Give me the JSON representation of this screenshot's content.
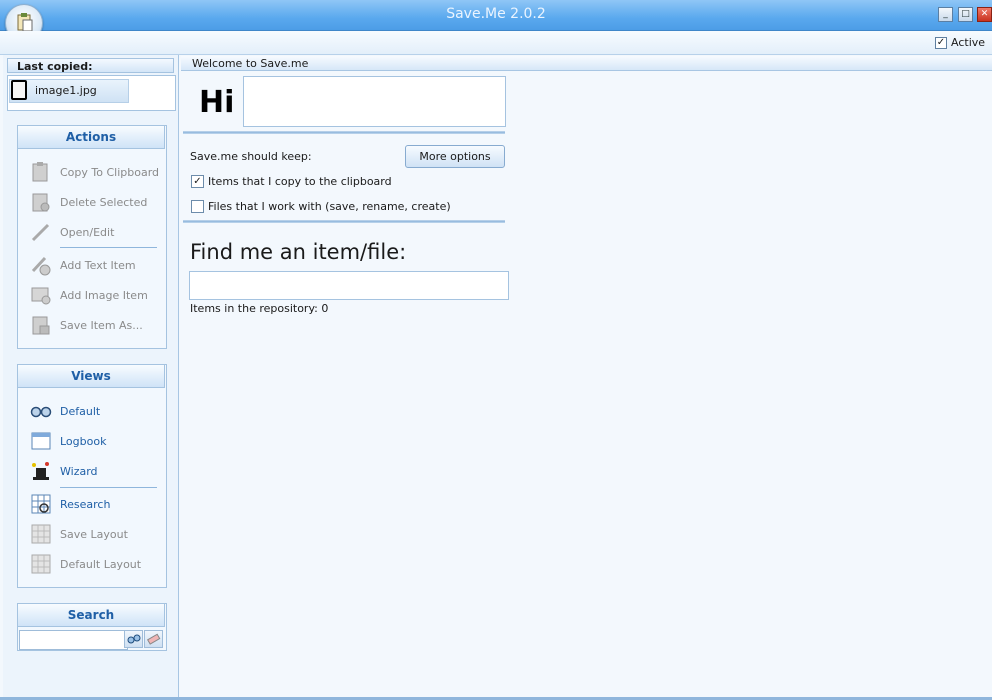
{
  "window": {
    "title": "Save.Me 2.0.2",
    "controls": {
      "minimize": "_",
      "maximize": "□",
      "close": "✕"
    }
  },
  "ribbon": {
    "active_label": "Active",
    "active_checked": true
  },
  "last_copied": {
    "header": "Last copied:",
    "file_name": "image1.jpg"
  },
  "actions": {
    "title": "Actions",
    "items": [
      {
        "label": "Copy To Clipboard",
        "icon": "clipboard-icon",
        "enabled": false
      },
      {
        "label": "Delete Selected",
        "icon": "delete-icon",
        "enabled": false
      },
      {
        "label": "Open/Edit",
        "icon": "pencil-icon",
        "enabled": false
      },
      {
        "label": "Add Text Item",
        "icon": "add-text-icon",
        "enabled": false
      },
      {
        "label": "Add Image Item",
        "icon": "add-image-icon",
        "enabled": false
      },
      {
        "label": "Save Item As...",
        "icon": "save-icon",
        "enabled": false
      }
    ]
  },
  "views": {
    "title": "Views",
    "items": [
      {
        "label": "Default",
        "icon": "glasses-icon",
        "enabled": true
      },
      {
        "label": "Logbook",
        "icon": "logbook-icon",
        "enabled": true
      },
      {
        "label": "Wizard",
        "icon": "wizard-hat-icon",
        "enabled": true
      },
      {
        "label": "Research",
        "icon": "research-grid-icon",
        "enabled": true
      },
      {
        "label": "Save Layout",
        "icon": "save-layout-icon",
        "enabled": false
      },
      {
        "label": "Default Layout",
        "icon": "default-layout-icon",
        "enabled": false
      }
    ]
  },
  "search": {
    "title": "Search",
    "value": ""
  },
  "main": {
    "header": "Welcome to Save.me",
    "greeting": "Hi",
    "keep_label": "Save.me should keep:",
    "more_options": "More options",
    "option_clipboard": {
      "label": "Items that I copy to the clipboard",
      "checked": true
    },
    "option_files": {
      "label": "Files that I work with (save, rename, create)",
      "checked": false
    },
    "find_label": "Find me an item/file:",
    "find_value": "",
    "repo_count": "Items in the repository: 0"
  }
}
